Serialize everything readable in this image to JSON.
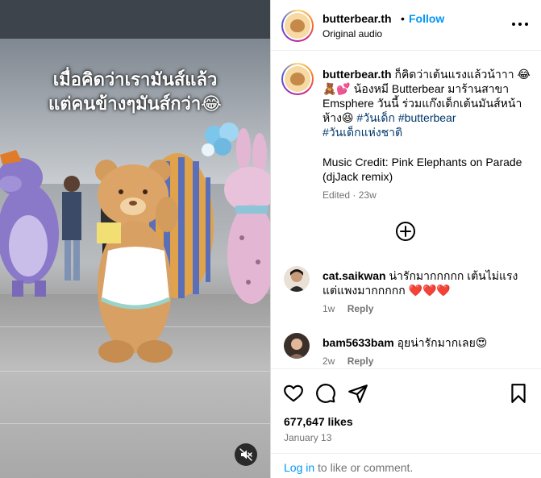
{
  "video": {
    "caption_line1": "เมื่อคิดว่าเรามันส์แล้ว",
    "caption_line2": "แต่คนข้างๆมันส์กว่า😂"
  },
  "header": {
    "username": "butterbear.th",
    "separator": "•",
    "follow_label": "Follow",
    "audio_label": "Original audio"
  },
  "post": {
    "username": "butterbear.th",
    "caption_text": "ก็คิดว่าเต้นแรงแล้วน้าาา 😂🧸💕 น้องหมี Butterbear มาร้านสาขา Emsphere วันนี้ ร่วมแก๊งเด็กเต้นมันส์หน้าห้าง😆",
    "hashtags": [
      "#วันเด็ก",
      "#butterbear",
      "#วันเด็กแห่งชาติ"
    ],
    "music_credit": "Music Credit: Pink Elephants on Parade (djJack remix)",
    "edited_label": "Edited",
    "edited_separator": "·",
    "edited_time": "23w"
  },
  "comments": [
    {
      "username": "cat.saikwan",
      "text": "น่ารักมากกกกก เต้นไม่แรงแต่แพงมากกกกก ❤️❤️❤️",
      "time": "1w",
      "reply_label": "Reply"
    },
    {
      "username": "bam5633bam",
      "text": "อุยน่ารักมากเลย😍",
      "time": "2w",
      "reply_label": "Reply"
    }
  ],
  "footer": {
    "likes": "677,647 likes",
    "date": "January 13",
    "login_link": "Log in",
    "login_rest": " to like or comment."
  },
  "icons": {
    "more": "more-options-icon",
    "add": "plus-circle-icon",
    "like": "heart-icon",
    "comment": "comment-icon",
    "share": "share-icon",
    "save": "bookmark-icon",
    "mute": "muted-speaker-icon"
  },
  "colors": {
    "accent_blue": "#0095f6",
    "hashtag_blue": "#00376b",
    "muted_gray": "#737373"
  }
}
